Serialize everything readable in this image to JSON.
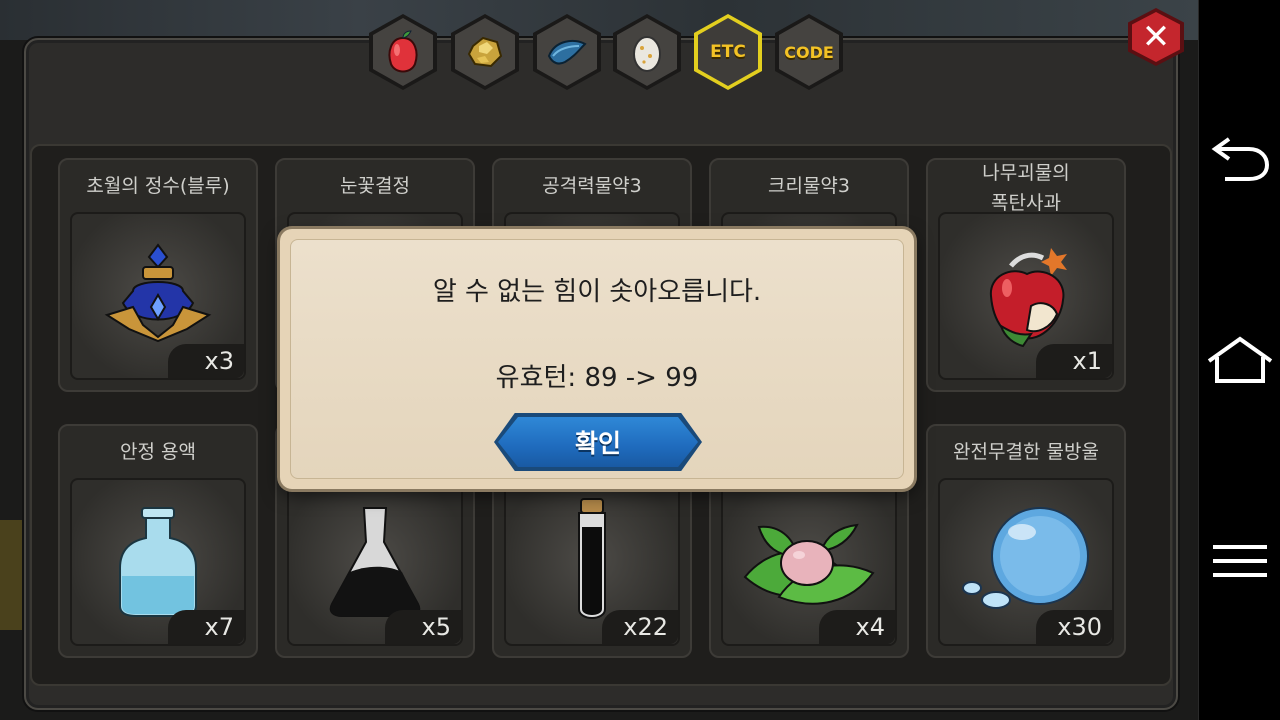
{
  "tabs": [
    {
      "name": "fruit",
      "icon": "fruit-icon",
      "text": ""
    },
    {
      "name": "ore",
      "icon": "gold-ore-icon",
      "text": ""
    },
    {
      "name": "fish",
      "icon": "fish-icon",
      "text": ""
    },
    {
      "name": "egg",
      "icon": "egg-icon",
      "text": ""
    },
    {
      "name": "etc",
      "icon": "",
      "text": "ETC",
      "active": true
    },
    {
      "name": "code",
      "icon": "",
      "text": "CODE"
    }
  ],
  "items": [
    {
      "name": "초월의 정수(블루)",
      "count": "x3",
      "icon": "blue-essence-icon"
    },
    {
      "name": "눈꽃결정",
      "count": "",
      "icon": ""
    },
    {
      "name": "공격력물약3",
      "count": "",
      "icon": ""
    },
    {
      "name": "크리물약3",
      "count": "",
      "icon": ""
    },
    {
      "name": "나무괴물의\n폭탄사과",
      "count": "x1",
      "icon": "bomb-apple-icon"
    },
    {
      "name": "안정 용액",
      "count": "x7",
      "icon": "bottle-icon"
    },
    {
      "name": "",
      "count": "x5",
      "icon": "dark-flask-icon"
    },
    {
      "name": "",
      "count": "x22",
      "icon": "test-tube-icon"
    },
    {
      "name": "",
      "count": "x4",
      "icon": "leaf-berry-icon"
    },
    {
      "name": "완전무결한 물방울",
      "count": "x30",
      "icon": "water-drop-icon"
    }
  ],
  "dialog": {
    "message": "알 수 없는 힘이 솟아오릅니다.",
    "detail": "유효턴: 89 -> 99",
    "confirm_label": "확인"
  },
  "colors": {
    "tab_active_border": "#e3cf1f",
    "tab_text": "#f4c325",
    "confirm_blue": "#1f6bbd",
    "close_red": "#c4262d",
    "dialog_paper": "#ece0cc"
  },
  "navbar": {
    "back_icon": "back-icon",
    "home_icon": "home-icon",
    "menu_icon": "menu-icon"
  }
}
